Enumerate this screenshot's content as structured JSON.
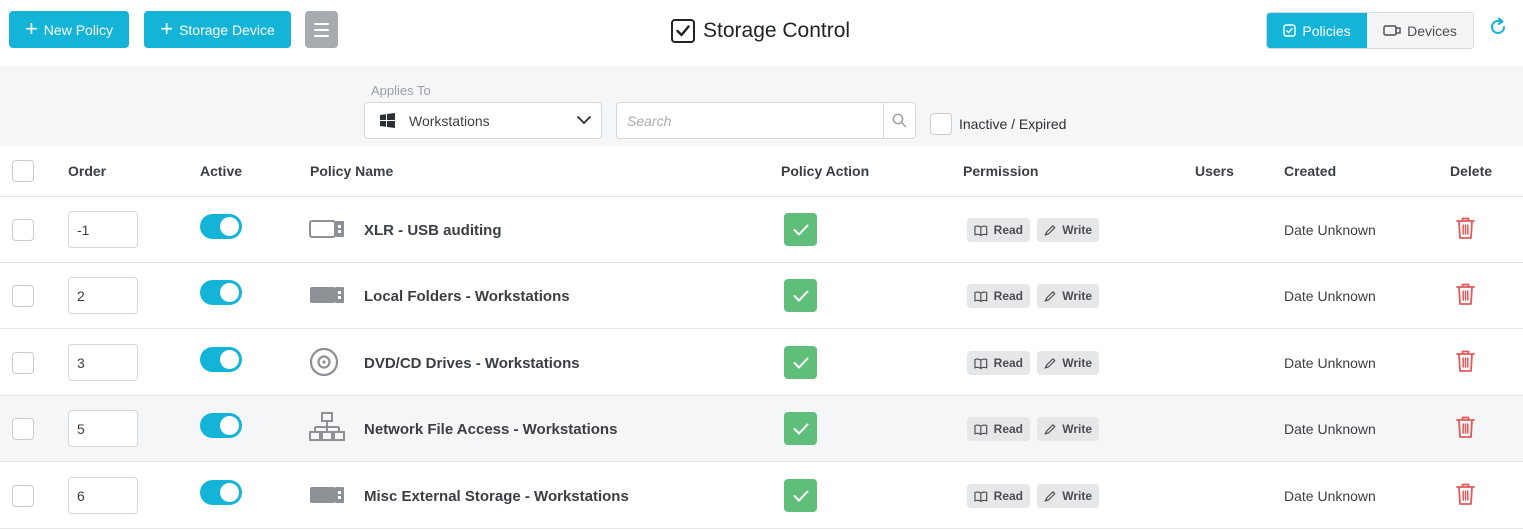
{
  "header": {
    "new_policy": "New Policy",
    "storage_device": "Storage Device",
    "title": "Storage Control",
    "view_policies": "Policies",
    "view_devices": "Devices"
  },
  "filters": {
    "applies_to_label": "Applies To",
    "applies_to_value": "Workstations",
    "search_placeholder": "Search",
    "inactive_label": "Inactive / Expired"
  },
  "columns": {
    "order": "Order",
    "active": "Active",
    "policy_name": "Policy Name",
    "policy_action": "Policy Action",
    "permission": "Permission",
    "users": "Users",
    "created": "Created",
    "delete": "Delete"
  },
  "permission_labels": {
    "read": "Read",
    "write": "Write"
  },
  "rows": [
    {
      "order": "-1",
      "name": "XLR - USB auditing",
      "icon": "usb-drive-outline-icon",
      "created": "Date Unknown",
      "active": true
    },
    {
      "order": "2",
      "name": "Local Folders - Workstations",
      "icon": "usb-drive-icon",
      "created": "Date Unknown",
      "active": true
    },
    {
      "order": "3",
      "name": "DVD/CD Drives - Workstations",
      "icon": "disc-icon",
      "created": "Date Unknown",
      "active": true
    },
    {
      "order": "5",
      "name": "Network File Access - Workstations",
      "icon": "network-icon",
      "created": "Date Unknown",
      "active": true
    },
    {
      "order": "6",
      "name": "Misc External Storage - Workstations",
      "icon": "usb-drive-icon",
      "created": "Date Unknown",
      "active": true
    }
  ],
  "colors": {
    "accent": "#14b4d8",
    "action_green": "#5fbf7a",
    "delete_red": "#e05a5a"
  }
}
